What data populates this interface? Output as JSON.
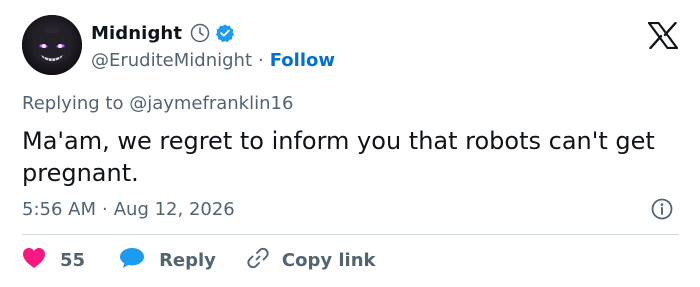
{
  "author": {
    "display_name": "Midnight",
    "handle": "@EruditeMidnight",
    "separator": "·",
    "follow_label": "Follow"
  },
  "reply_context": {
    "prefix": "Replying to",
    "mention": "@jaymefranklin16"
  },
  "tweet": {
    "text": "Ma'am, we regret to inform you that robots can't get pregnant."
  },
  "meta": {
    "time": "5:56 AM",
    "separator": "·",
    "date": "Aug 12, 2026"
  },
  "actions": {
    "like_count": "55",
    "reply_label": "Reply",
    "copy_label": "Copy link"
  },
  "icons": {
    "avatar": "avatar-image",
    "clock": "clock-icon",
    "verified": "verified-badge-icon",
    "brand": "x-logo-icon",
    "info": "info-icon",
    "like": "heart-icon",
    "reply": "speech-bubble-icon",
    "copy": "link-icon"
  },
  "colors": {
    "text": "#0f1419",
    "muted": "#536471",
    "link": "#006fd6",
    "verified": "#1d9bf0",
    "like": "#f91880",
    "reply": "#1d9bf0",
    "divider": "#cfd9de"
  }
}
